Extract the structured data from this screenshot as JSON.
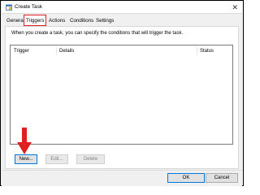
{
  "window": {
    "title": "Create Task",
    "close_glyph": "✕"
  },
  "tabs": [
    {
      "label": "General"
    },
    {
      "label": "Triggers"
    },
    {
      "label": "Actions"
    },
    {
      "label": "Conditions"
    },
    {
      "label": "Settings"
    }
  ],
  "panel": {
    "description": "When you create a task, you can specify the conditions that will trigger the task."
  },
  "table": {
    "columns": [
      "Trigger",
      "Details",
      "Status"
    ]
  },
  "buttons": {
    "new": "New...",
    "edit": "Edit...",
    "delete": "Delete"
  },
  "footer": {
    "ok": "OK",
    "cancel": "Cancel"
  },
  "colors": {
    "highlight": "#e02020",
    "accent": "#0078d7"
  },
  "icons": [
    "task-scheduler-icon",
    "close-icon",
    "red-arrow-icon"
  ]
}
